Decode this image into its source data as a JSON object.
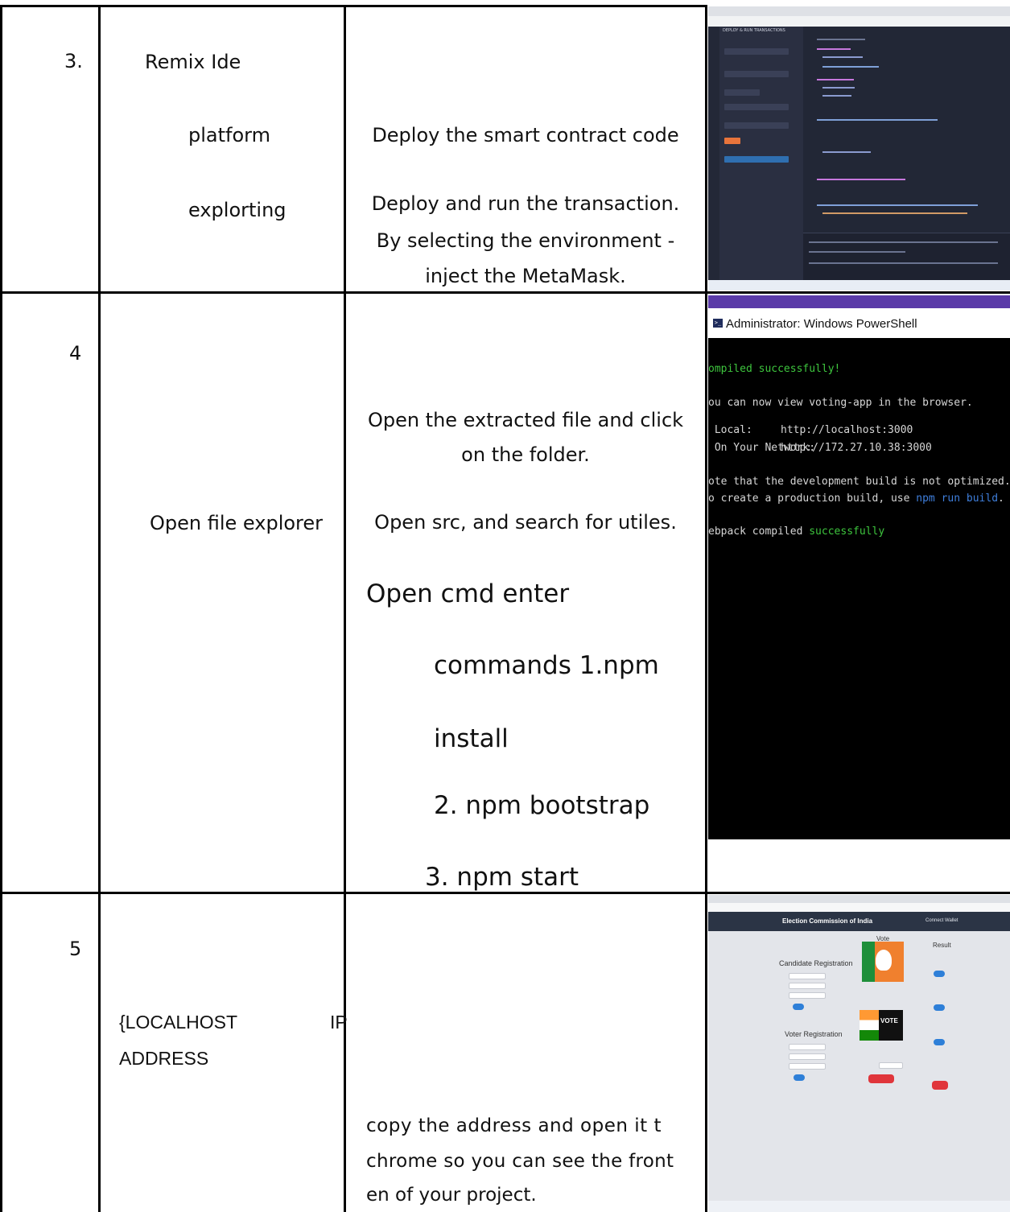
{
  "rows": [
    {
      "step": "3.",
      "component_lines": [
        "Remix Ide",
        "platform",
        "explorting"
      ],
      "description_lines": [
        "Deploy the smart contract code",
        "Deploy and run the transaction.",
        "By selecting the environment -",
        "inject the MetaMask."
      ]
    },
    {
      "step": "4",
      "component": "Open file explorer",
      "description_lines": [
        "Open the extracted file and click",
        "on the folder.",
        "Open src, and search for utiles."
      ],
      "command_lines": [
        "Open cmd enter",
        "commands 1.npm",
        "install",
        "2. npm bootstrap",
        "3.  npm start"
      ]
    },
    {
      "step": "5",
      "component_lines": [
        "{LOCALHOST",
        "IP",
        "ADDRESS"
      ],
      "description_lines": [
        "copy the address and open it t",
        "chrome so you can see the front",
        "en of your project."
      ]
    }
  ],
  "powershell": {
    "title": "Administrator: Windows PowerShell",
    "line1": "ompiled successfully!",
    "line2": "ou can now view voting-app in the browser.",
    "local_label": " Local:",
    "local_url": "http://localhost:3000",
    "network_label": " On Your Network:",
    "network_url": "http://172.27.10.38:3000",
    "note1": "ote that the development build is not optimized.",
    "note2_prefix": "o create a production build, use ",
    "note2_cmd": "npm run build",
    "note2_suffix": ".",
    "webpack_prefix": "ebpack compiled ",
    "webpack_status": "successfully"
  },
  "remix": {
    "panel_title": "DEPLOY & RUN TRANSACTIONS"
  },
  "election": {
    "header_title": "Election Commission of India",
    "connect": "Connect Wallet",
    "candidate_heading": "Candidate Registration",
    "voter_heading": "Voter Registration",
    "vote_heading": "Vote",
    "result_heading": "Result",
    "vote_logo_text": "VOTE"
  },
  "colors": {
    "rule": "#000000",
    "remix_bg": "#1e2230",
    "terminal_green": "#3ec63e",
    "terminal_blue": "#3f7fdc"
  }
}
